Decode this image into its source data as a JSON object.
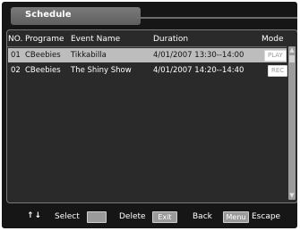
{
  "header": {
    "title": "Schedule"
  },
  "table": {
    "columns": [
      "NO.",
      "Programe",
      "Event Name",
      "Duration",
      "Mode"
    ],
    "rows": [
      {
        "no": "01",
        "programme": "CBeebies",
        "event": "Tikkabilla",
        "duration": "4/01/2007  13:30--14:00",
        "mode": "PLAY"
      },
      {
        "no": "02",
        "programme": "CBeebies",
        "event": "The Shiny Show",
        "duration": "4/01/2007  14:20--14:40",
        "mode": "REC"
      }
    ]
  },
  "footer": {
    "select_icon": "up-down-arrows-icon",
    "select_label": "Select",
    "delete_label": "Delete",
    "exit_key": "Exit",
    "back_label": "Back",
    "menu_key": "Menu",
    "escape_label": "Escape"
  },
  "colors": {
    "background": "#161616",
    "panel": "#2a2a2a",
    "selected_row": "#bdbdbd"
  }
}
